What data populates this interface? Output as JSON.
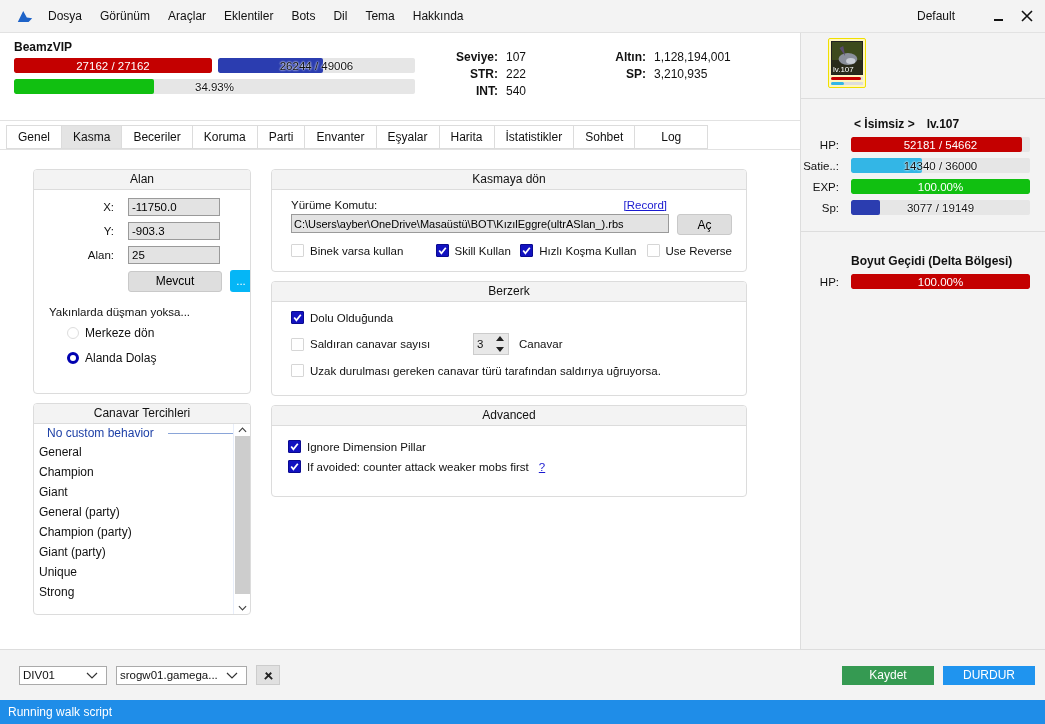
{
  "menu": [
    "Dosya",
    "Görünüm",
    "Araçlar",
    "Eklentiler",
    "Bots",
    "Dil",
    "Tema",
    "Hakkında"
  ],
  "profile": "Default",
  "character": {
    "name": "BeamzVIP",
    "bars": [
      {
        "kind": "hp",
        "text": "27162 / 27162",
        "level": 1
      },
      {
        "kind": "mp",
        "text": "26244 / 49006",
        "level": 0.5355
      },
      {
        "kind": "exp",
        "text": "34.93%",
        "level": 0.3493
      }
    ],
    "stats": [
      {
        "label": "Seviye:",
        "value": "107"
      },
      {
        "label": "STR:",
        "value": "222"
      },
      {
        "label": "INT:",
        "value": "540"
      }
    ],
    "money": [
      {
        "label": "Altın:",
        "value": "1,128,194,001"
      },
      {
        "label": "SP:",
        "value": "3,210,935"
      }
    ]
  },
  "tabs": [
    {
      "label": "Genel",
      "selected": false
    },
    {
      "label": "Kasma",
      "selected": true
    },
    {
      "label": "Beceriler",
      "selected": false
    },
    {
      "label": "Koruma",
      "selected": false
    },
    {
      "label": "Parti",
      "selected": false
    },
    {
      "label": "Envanter",
      "selected": false
    },
    {
      "label": "Eşyalar",
      "selected": false
    },
    {
      "label": "Harita",
      "selected": false
    },
    {
      "label": "İstatistikler",
      "selected": false
    },
    {
      "label": "Sohbet",
      "selected": false
    },
    {
      "label": "Log",
      "selected": false
    }
  ],
  "area": {
    "title": "Alan",
    "fields": [
      {
        "label": "X:",
        "value": "-11750.0"
      },
      {
        "label": "Y:",
        "value": "-903.3"
      },
      {
        "label": "Alan:",
        "value": "25"
      }
    ],
    "current_button": "Mevcut",
    "more_button": "...",
    "prompt": "Yakınlarda düşman yoksa...",
    "options": [
      {
        "label": "Merkeze dön",
        "selected": false
      },
      {
        "label": "Alanda Dolaş",
        "selected": true
      }
    ]
  },
  "monster_prefs": {
    "title": "Canavar Tercihleri",
    "header": "No custom behavior",
    "items": [
      "General",
      "Champion",
      "Giant",
      "General (party)",
      "Champion (party)",
      "Giant (party)",
      "Unique",
      "Strong"
    ]
  },
  "return_group": {
    "title": "Kasmaya dön",
    "walk_label": "Yürüme Komutu:",
    "record_link": "[Record]",
    "path": "C:\\Users\\ayber\\OneDrive\\Masaüstü\\BOT\\KızılEggre(ultrASlan_).rbs",
    "open_button": "Aç",
    "checks": [
      {
        "label": "Binek varsa kullan",
        "checked": false
      },
      {
        "label": "Skill Kullan",
        "checked": true
      },
      {
        "label": "Hızlı Koşma Kullan",
        "checked": true
      },
      {
        "label": "Use Reverse",
        "checked": false
      }
    ]
  },
  "berserk": {
    "title": "Berzerk",
    "full": {
      "label": "Dolu Olduğunda",
      "checked": true
    },
    "count": {
      "label": "Saldıran canavar sayısı",
      "checked": false,
      "value": "3",
      "unit": "Canavar"
    },
    "avoid": {
      "label": "Uzak durulması gereken canavar türü tarafından saldırıya uğruyorsa.",
      "checked": false
    }
  },
  "advanced": {
    "title": "Advanced",
    "checks": [
      {
        "label": "Ignore Dimension Pillar",
        "checked": true
      },
      {
        "label": "If avoided: counter attack weaker mobs first",
        "checked": true,
        "help": "?"
      }
    ]
  },
  "party_panel": {
    "avatar": {
      "level": "lv.107",
      "bars": [
        {
          "kind": "hp",
          "level": 0.95
        },
        {
          "kind": "satiety",
          "level": 0.4
        }
      ]
    },
    "member": {
      "name": "< İsimsiz >",
      "level": "lv.107",
      "bars": [
        {
          "label": "HP:",
          "kind": "hp",
          "text": "52181 / 54662",
          "level": 0.9546
        },
        {
          "label": "Satie..:",
          "kind": "satiety",
          "text": "14340 / 36000",
          "level": 0.3983
        },
        {
          "label": "EXP:",
          "kind": "exp",
          "text": "100.00%",
          "level": 1
        },
        {
          "label": "Sp:",
          "kind": "mp",
          "text": "3077 / 19149",
          "level": 0.1607
        }
      ]
    },
    "target": {
      "name": "Boyut Geçidi (Delta Bölgesi)",
      "bars": [
        {
          "label": "HP:",
          "kind": "hp",
          "text": "100.00%",
          "level": 1
        }
      ]
    }
  },
  "bottom": {
    "division": "DIV01",
    "server": "srogw01.gamega...",
    "save_button": "Kaydet",
    "stop_button": "DURDUR"
  },
  "status_bar": "Running walk script"
}
